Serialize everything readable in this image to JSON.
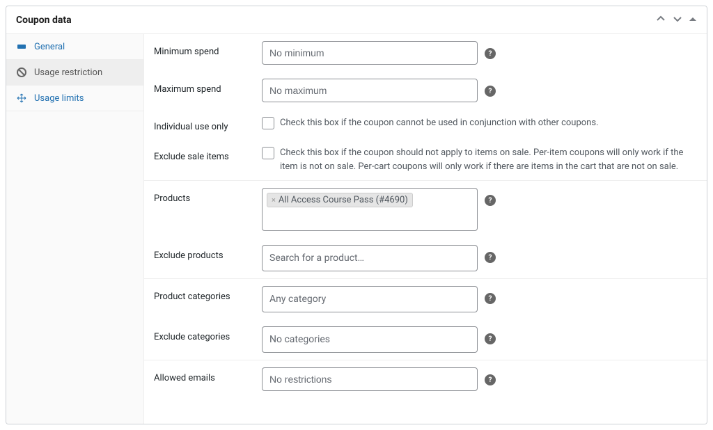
{
  "panel": {
    "title": "Coupon data"
  },
  "tabs": [
    {
      "label": "General"
    },
    {
      "label": "Usage restriction"
    },
    {
      "label": "Usage limits"
    }
  ],
  "fields": {
    "minimum_spend": {
      "label": "Minimum spend",
      "placeholder": "No minimum"
    },
    "maximum_spend": {
      "label": "Maximum spend",
      "placeholder": "No maximum"
    },
    "individual_use": {
      "label": "Individual use only",
      "description": "Check this box if the coupon cannot be used in conjunction with other coupons."
    },
    "exclude_sale_items": {
      "label": "Exclude sale items",
      "description": "Check this box if the coupon should not apply to items on sale. Per-item coupons will only work if the item is not on sale. Per-cart coupons will only work if there are items in the cart that are not on sale."
    },
    "products": {
      "label": "Products",
      "selected": [
        {
          "name": "All Access Course Pass (#4690)"
        }
      ]
    },
    "exclude_products": {
      "label": "Exclude products",
      "placeholder": "Search for a product…"
    },
    "product_categories": {
      "label": "Product categories",
      "placeholder": "Any category"
    },
    "exclude_categories": {
      "label": "Exclude categories",
      "placeholder": "No categories"
    },
    "allowed_emails": {
      "label": "Allowed emails",
      "placeholder": "No restrictions"
    }
  }
}
